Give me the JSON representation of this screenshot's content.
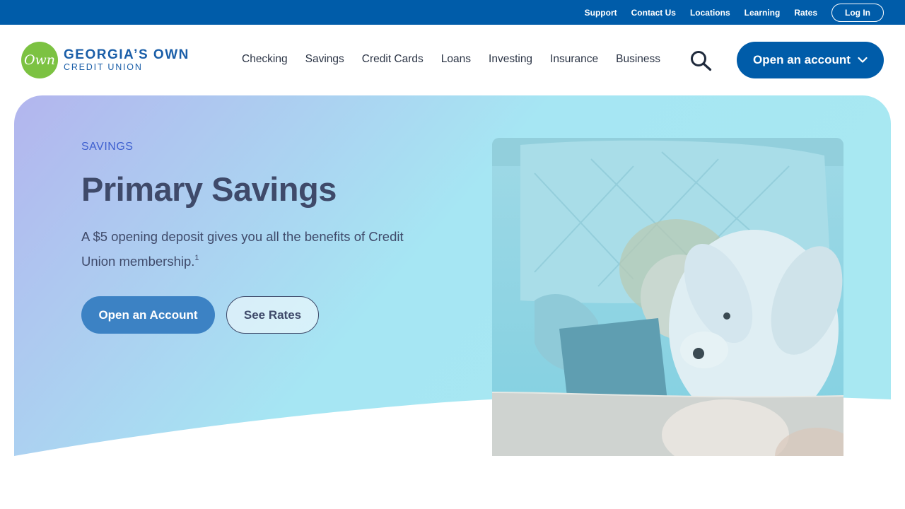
{
  "utility": {
    "links": [
      "Support",
      "Contact Us",
      "Locations",
      "Learning",
      "Rates"
    ],
    "login_label": "Log In"
  },
  "logo": {
    "mark": "Own",
    "line1": "GEORGIA’S OWN",
    "line2": "CREDIT UNION"
  },
  "nav": {
    "items": [
      "Checking",
      "Savings",
      "Credit Cards",
      "Loans",
      "Investing",
      "Insurance",
      "Business"
    ],
    "search_icon": "search-icon",
    "cta_label": "Open an account"
  },
  "hero": {
    "eyebrow": "SAVINGS",
    "title": "Primary Savings",
    "description": "A $5 opening deposit gives you all the benefits of Credit Union membership.",
    "footnote": "1",
    "primary_button": "Open an Account",
    "secondary_button": "See Rates"
  },
  "colors": {
    "brand_blue": "#005ca9",
    "logo_green": "#7cc242",
    "hero_gradient_start": "#b3b5ee",
    "hero_gradient_end": "#a6e6f3",
    "button_blue": "#3c82c4"
  }
}
